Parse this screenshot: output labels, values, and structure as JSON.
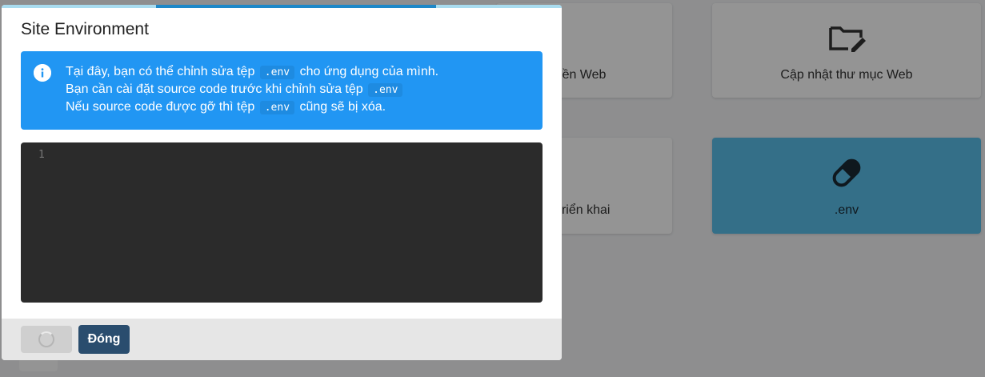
{
  "background": {
    "cards": [
      {
        "label": "ền Web",
        "icon": "globe-icon"
      },
      {
        "label": "Cập nhật thư mục Web",
        "icon": "folder-edit-icon"
      },
      {
        "label": "triển khai",
        "icon": "deploy-icon"
      },
      {
        "label": ".env",
        "icon": "pill-icon",
        "active": true
      }
    ]
  },
  "modal": {
    "title": "Site Environment",
    "progress_percent": 50,
    "alert": {
      "icon": "info-icon",
      "line1_before": "Tại đây, bạn có thể chỉnh sửa tệp",
      "line1_code": ".env",
      "line1_after": "cho ứng dụng của mình.",
      "line2_before": "Bạn cần cài đặt source code trước khi chỉnh sửa tệp",
      "line2_code": ".env",
      "line3_before": "Nếu source code được gỡ thì tệp",
      "line3_code": ".env",
      "line3_after": "cũng sẽ bị xóa."
    },
    "editor": {
      "line_number": "1"
    },
    "footer": {
      "close_label": "Đóng"
    }
  },
  "colors": {
    "alert_bg": "#2196f3",
    "editor_bg": "#2b2b2b",
    "close_button_bg": "#2a4d6e",
    "active_card_bg": "#5bc0eb"
  }
}
